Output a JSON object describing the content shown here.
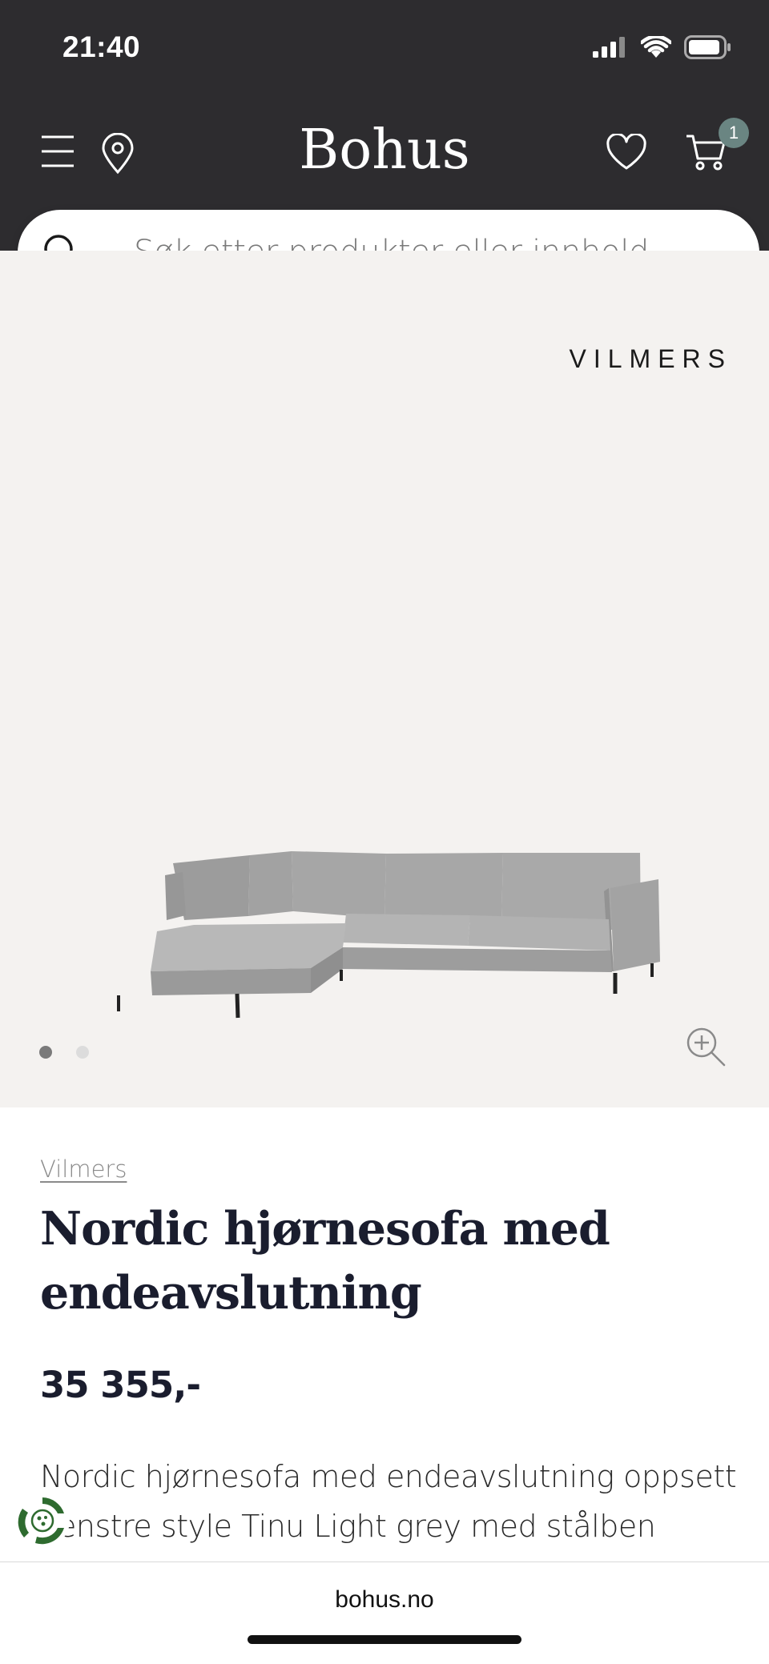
{
  "status_bar": {
    "time": "21:40"
  },
  "header": {
    "brand": "Bohus",
    "cart_count": "1",
    "icons": [
      "menu-icon",
      "location-pin-icon",
      "heart-icon",
      "cart-icon"
    ]
  },
  "search": {
    "placeholder": "Søk etter produkter eller innhold..."
  },
  "gallery": {
    "brand_mark": "VILMERS",
    "image": "sofa-product-image",
    "dots": 2,
    "active_dot": 0
  },
  "product": {
    "vendor": "Vilmers",
    "title": "Nordic hjørnesofa med endeavslutning",
    "price": "35 355,-",
    "description": "Nordic hjørnesofa med endeavslutning oppsett venstre style Tinu Light grey med stålben"
  },
  "browser": {
    "url": "bohus.no"
  },
  "colors": {
    "header_bg": "#2d2c2f",
    "badge": "#6a8582",
    "gallery_bg": "#f4f2f0",
    "text_dark": "#1a1d2e",
    "eco_green": "#2e6b2f"
  }
}
